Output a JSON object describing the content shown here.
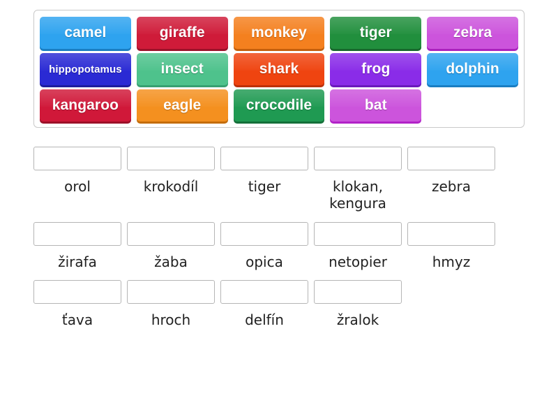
{
  "word_bank": {
    "rows": [
      [
        {
          "label": "camel",
          "color": "#2ea3ef",
          "shadow": "#1a7ec2",
          "small": false
        },
        {
          "label": "giraffe",
          "color": "#cf1b39",
          "shadow": "#9c1129",
          "small": false
        },
        {
          "label": "monkey",
          "color": "#f4801f",
          "shadow": "#c45f0c",
          "small": false
        },
        {
          "label": "tiger",
          "color": "#218f3d",
          "shadow": "#17682c",
          "small": false
        },
        {
          "label": "zebra",
          "color": "#cc54dc",
          "shadow": "#aa22bd",
          "small": false
        }
      ],
      [
        {
          "label": "hippopotamus",
          "color": "#2a2ad4",
          "shadow": "#1c1c9e",
          "small": true
        },
        {
          "label": "insect",
          "color": "#4ec28c",
          "shadow": "#37a071",
          "small": false
        },
        {
          "label": "shark",
          "color": "#ef4410",
          "shadow": "#bd3008",
          "small": false
        },
        {
          "label": "frog",
          "color": "#8a2ce8",
          "shadow": "#6a19bb",
          "small": false
        },
        {
          "label": "dolphin",
          "color": "#2ea3ef",
          "shadow": "#1a7ec2",
          "small": false
        }
      ],
      [
        {
          "label": "kangaroo",
          "color": "#d01839",
          "shadow": "#9c1129",
          "small": false
        },
        {
          "label": "eagle",
          "color": "#f4901f",
          "shadow": "#c46d0c",
          "small": false
        },
        {
          "label": "crocodile",
          "color": "#1f9a52",
          "shadow": "#15703a",
          "small": false
        },
        {
          "label": "bat",
          "color": "#cc54dc",
          "shadow": "#b222c8",
          "small": false
        },
        {
          "label": "",
          "color": "",
          "shadow": "",
          "small": false,
          "blank": true
        }
      ]
    ]
  },
  "answers": {
    "rows": [
      [
        {
          "label": "orol"
        },
        {
          "label": "krokodíl"
        },
        {
          "label": "tiger"
        },
        {
          "label": "klokan, kengura"
        },
        {
          "label": "zebra"
        }
      ],
      [
        {
          "label": "žirafa"
        },
        {
          "label": "žaba"
        },
        {
          "label": "opica"
        },
        {
          "label": "netopier"
        },
        {
          "label": "hmyz"
        }
      ],
      [
        {
          "label": "ťava"
        },
        {
          "label": "hroch"
        },
        {
          "label": "delfín"
        },
        {
          "label": "žralok"
        },
        {
          "label": "",
          "empty": true
        }
      ]
    ]
  }
}
